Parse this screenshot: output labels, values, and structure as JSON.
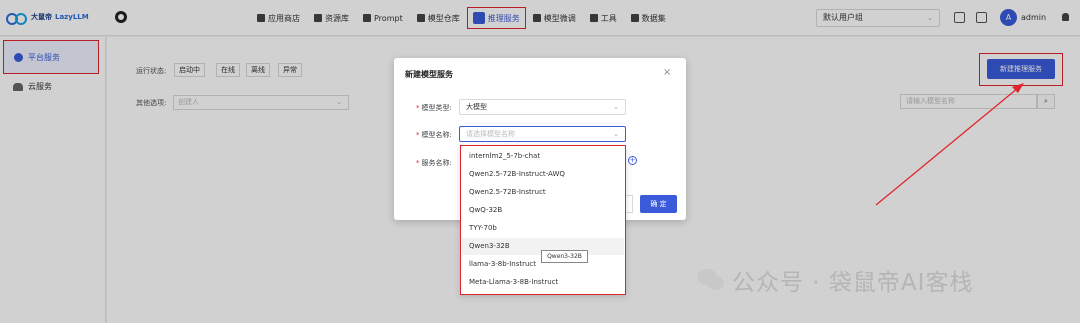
{
  "brand": {
    "name_cn": "大鼠帝",
    "name_en": "LazyLLM"
  },
  "nav": {
    "items": [
      {
        "label": "应用商店"
      },
      {
        "label": "资源库"
      },
      {
        "label": "Prompt"
      },
      {
        "label": "模型仓库"
      },
      {
        "label": "推理服务"
      },
      {
        "label": "模型微调"
      },
      {
        "label": "工具"
      },
      {
        "label": "数据集"
      }
    ]
  },
  "header": {
    "group_select": "默认用户组",
    "avatar_letter": "A",
    "user_name": "admin"
  },
  "sidebar": {
    "items": [
      {
        "label": "平台服务"
      },
      {
        "label": "云服务"
      }
    ]
  },
  "filters": {
    "status_label": "运行状态:",
    "status_chips": [
      "启动中",
      "在线",
      "离线",
      "异常"
    ],
    "other_label": "其他选项:",
    "creator_placeholder": "创建人",
    "search_placeholder": "请输入模型名称"
  },
  "actions": {
    "new_service": "新建推理服务"
  },
  "modal": {
    "title": "新建模型服务",
    "close": "×",
    "model_type_label": "模型类型:",
    "model_type_value": "大模型",
    "model_name_label": "模型名称:",
    "model_name_placeholder": "请选择模型名称",
    "service_name_label": "服务名称:",
    "cancel_label": "",
    "ok_label": "确 定"
  },
  "dropdown": {
    "options": [
      "internlm2_5-7b-chat",
      "Qwen2.5-72B-Instruct-AWQ",
      "Qwen2.5-72B-Instruct",
      "QwQ-32B",
      "TYY-70b",
      "Qwen3-32B",
      "llama-3-8b-Instruct",
      "Meta-Llama-3-8B-Instruct"
    ],
    "tooltip": "Qwen3-32B"
  },
  "watermark": {
    "text": "公众号 · 袋鼠帝AI客栈"
  },
  "colors": {
    "accent": "#3b5bdb",
    "highlight": "#e0242a"
  }
}
